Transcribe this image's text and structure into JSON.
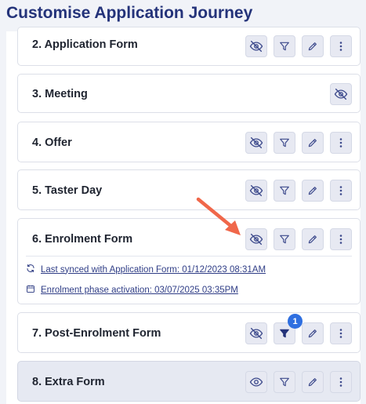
{
  "page": {
    "title": "Customise Application Journey"
  },
  "stages": [
    {
      "name": "2. Application Form",
      "actions": [
        "visibility-off",
        "filter",
        "edit",
        "more"
      ]
    },
    {
      "name": "3. Meeting",
      "actions": [
        "visibility-off"
      ]
    },
    {
      "name": "4. Offer",
      "actions": [
        "visibility-off",
        "filter",
        "edit",
        "more"
      ]
    },
    {
      "name": "5. Taster Day",
      "actions": [
        "visibility-off",
        "filter",
        "edit",
        "more"
      ]
    },
    {
      "name": "6. Enrolment Form",
      "actions": [
        "visibility-off",
        "filter",
        "edit",
        "more"
      ],
      "sync_info": "Last synced with Application Form: 01/12/2023 08:31AM",
      "activation_info": "Enrolment phase activation: 03/07/2025 03:35PM"
    },
    {
      "name": "7. Post-Enrolment Form",
      "actions": [
        "visibility-off",
        "filter-active",
        "edit",
        "more"
      ],
      "filter_count": "1"
    },
    {
      "name": "8. Extra Form",
      "actions": [
        "visibility-on",
        "filter",
        "edit",
        "more"
      ],
      "disabled": true
    }
  ],
  "colors": {
    "title": "#24337a",
    "accent": "#2f6fe0",
    "icon": "#3d4a8c",
    "annotation_arrow": "#f0674a"
  }
}
